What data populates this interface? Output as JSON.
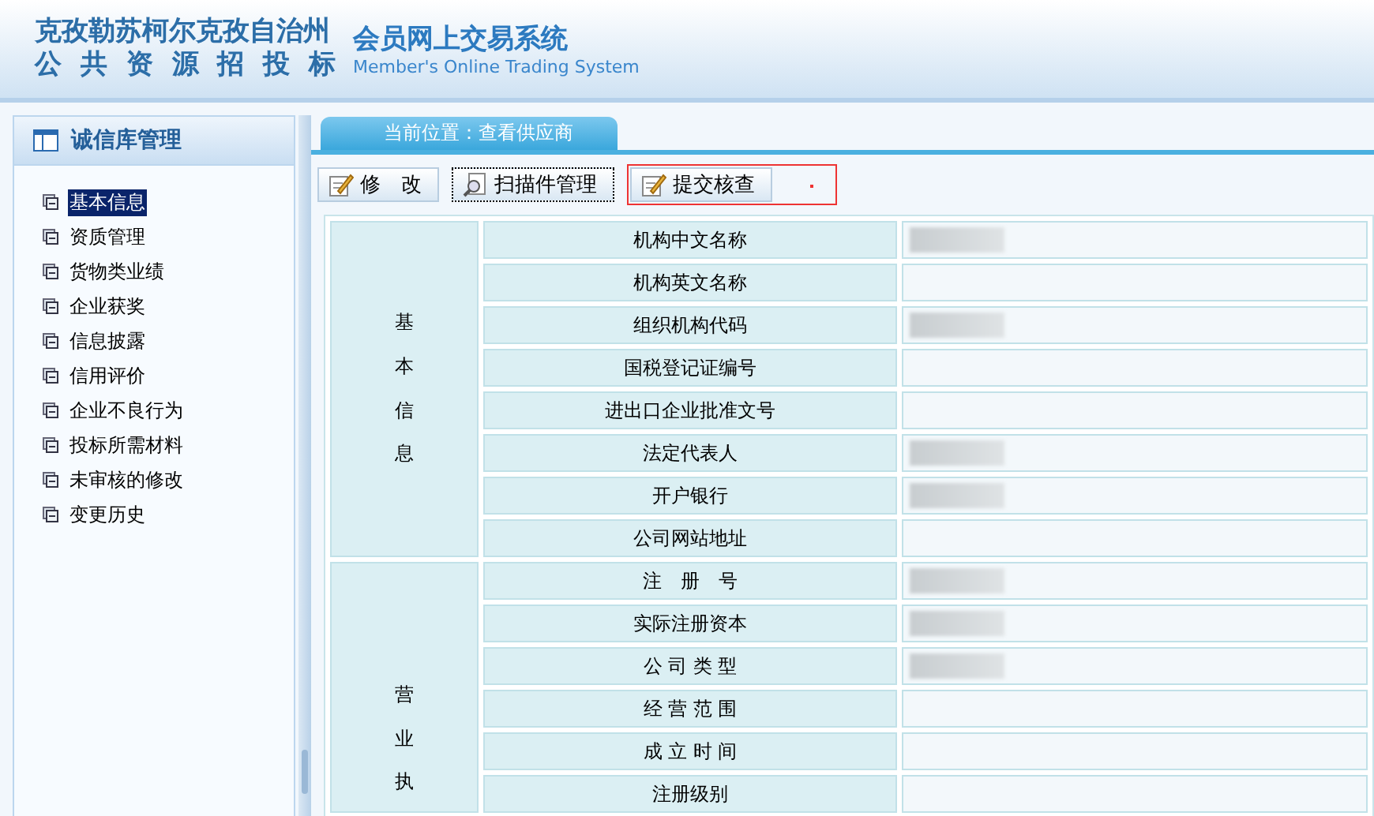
{
  "header": {
    "title_line1": "克孜勒苏柯尔克孜自治州",
    "title_line2": "公 共 资 源 招 投 标",
    "system_name": "会员网上交易系统",
    "system_name_en": "Member's Online Trading System"
  },
  "sidebar": {
    "title": "诚信库管理",
    "items": [
      {
        "label": "基本信息",
        "selected": true
      },
      {
        "label": "资质管理",
        "selected": false
      },
      {
        "label": "货物类业绩",
        "selected": false
      },
      {
        "label": "企业获奖",
        "selected": false
      },
      {
        "label": "信息披露",
        "selected": false
      },
      {
        "label": "信用评价",
        "selected": false
      },
      {
        "label": "企业不良行为",
        "selected": false
      },
      {
        "label": "投标所需材料",
        "selected": false
      },
      {
        "label": "未审核的修改",
        "selected": false
      },
      {
        "label": "变更历史",
        "selected": false
      }
    ]
  },
  "breadcrumb": "当前位置：查看供应商",
  "toolbar": [
    {
      "label": "修　改",
      "kind": "edit",
      "highlighted": false,
      "focused": false
    },
    {
      "label": "扫描件管理",
      "kind": "scan",
      "highlighted": false,
      "focused": true
    },
    {
      "label": "提交核查",
      "kind": "edit",
      "highlighted": true,
      "focused": false
    }
  ],
  "groups": [
    {
      "label": "基本信息",
      "rows": [
        {
          "field": "机构中文名称",
          "blurred": true
        },
        {
          "field": "机构英文名称",
          "blurred": false
        },
        {
          "field": "组织机构代码",
          "blurred": true
        },
        {
          "field": "国税登记证编号",
          "blurred": false
        },
        {
          "field": "进出口企业批准文号",
          "blurred": false
        },
        {
          "field": "法定代表人",
          "blurred": true
        },
        {
          "field": "开户银行",
          "blurred": true
        },
        {
          "field": "公司网站地址",
          "blurred": false
        }
      ]
    },
    {
      "label": "营业执",
      "rows": [
        {
          "field": "注　册　号",
          "blurred": true
        },
        {
          "field": "实际注册资本",
          "blurred": true
        },
        {
          "field": "公 司 类 型",
          "blurred": true
        },
        {
          "field": "经 营 范 围",
          "blurred": false
        },
        {
          "field": "成 立 时 间",
          "blurred": false
        },
        {
          "field": "注册级别",
          "blurred": false
        }
      ]
    }
  ]
}
